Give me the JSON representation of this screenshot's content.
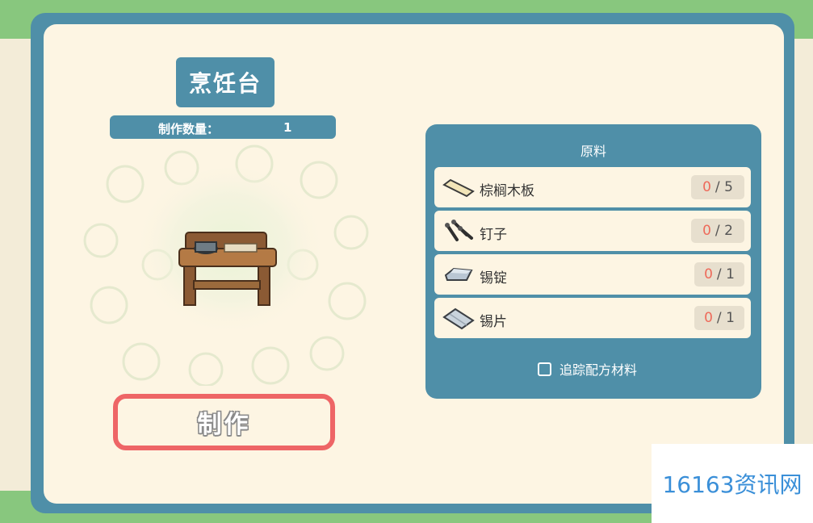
{
  "title": "烹饪台",
  "quantity": {
    "label": "制作数量：",
    "value": "1"
  },
  "craft_button": "制作",
  "materials": {
    "header": "原料",
    "items": [
      {
        "name": "棕榈木板",
        "have": "0",
        "sep": "/",
        "need": "5",
        "icon": "palm-plank-icon"
      },
      {
        "name": "钉子",
        "have": "0",
        "sep": "/",
        "need": "2",
        "icon": "nails-icon"
      },
      {
        "name": "锡锭",
        "have": "0",
        "sep": "/",
        "need": "1",
        "icon": "tin-ingot-icon"
      },
      {
        "name": "锡片",
        "have": "0",
        "sep": "/",
        "need": "1",
        "icon": "tin-sheet-icon"
      }
    ]
  },
  "track_label": "追踪配方材料",
  "watermark": "16163资讯网",
  "colors": {
    "panel": "#4f8fa8",
    "cream": "#fdf5e3",
    "craft_border": "#ee6566",
    "have_count": "#ee6a5a",
    "bg_green": "#88c77e"
  }
}
